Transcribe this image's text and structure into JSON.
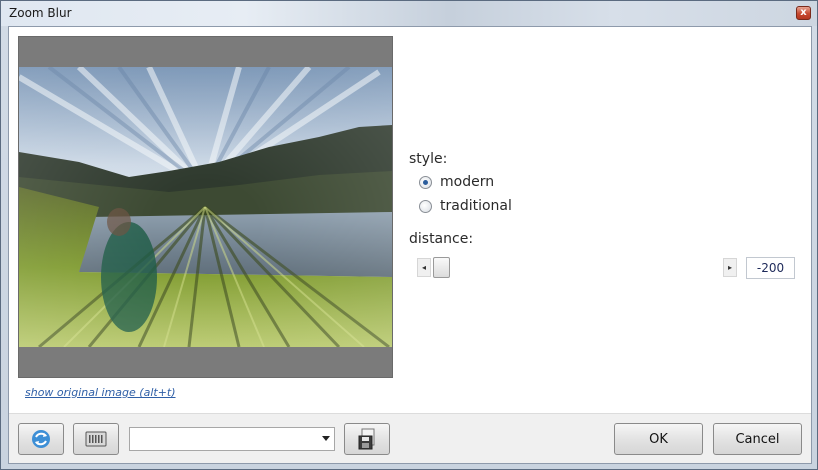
{
  "window": {
    "title": "Zoom Blur",
    "close_glyph": "x"
  },
  "preview": {
    "show_original_label": "show original image (alt+t)"
  },
  "controls": {
    "style_label": "style:",
    "style_options": [
      {
        "label": "modern",
        "selected": true
      },
      {
        "label": "traditional",
        "selected": false
      }
    ],
    "distance_label": "distance:",
    "distance_value": "-200",
    "slider_left_glyph": "◂",
    "slider_right_glyph": "▸"
  },
  "footer": {
    "preset_value": "",
    "ok_label": "OK",
    "cancel_label": "Cancel"
  },
  "icons": {
    "reset": "refresh-icon",
    "randomize": "keyboard-icon",
    "save": "save-preset-icon"
  }
}
